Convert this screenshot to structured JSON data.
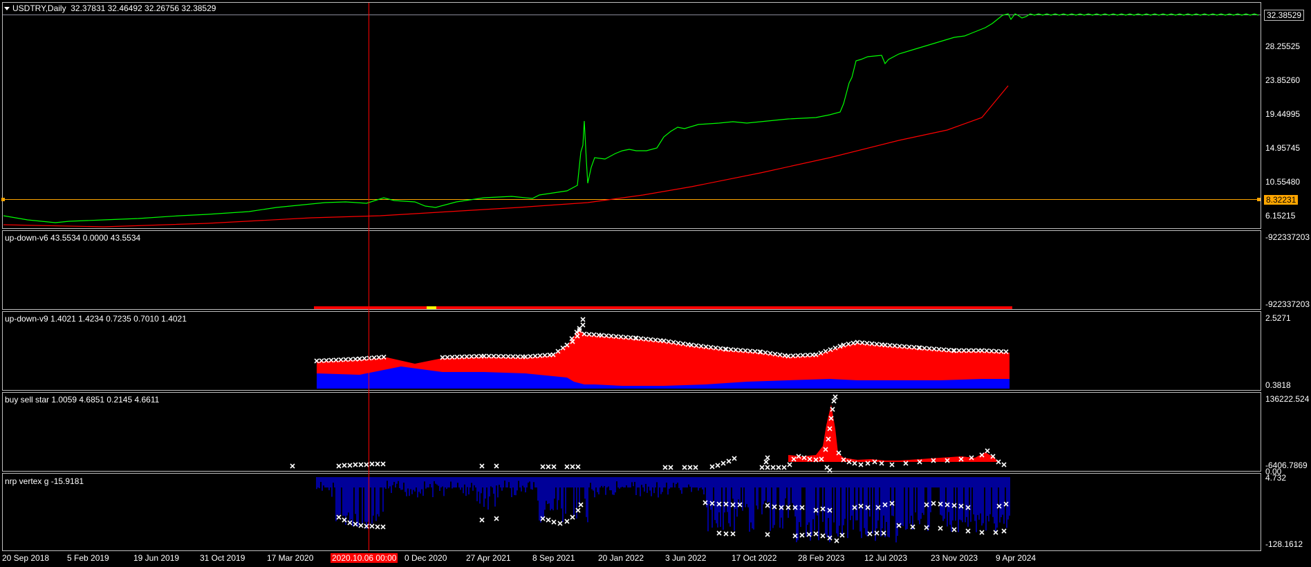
{
  "main": {
    "symbol": "USDTRY,Daily",
    "ohlc": "32.37831 32.46492 32.26756 32.38529",
    "current_price": "32.38529",
    "line_price": "8.32231",
    "scale": [
      "28.25525",
      "23.85260",
      "19.44995",
      "14.95745",
      "10.55480",
      "6.15215"
    ],
    "price_color": "#00ff00",
    "ma_color": "#ff0000",
    "hline_color": "#ffa500"
  },
  "indicators": [
    {
      "title": "up-down-v6  43.5534 0.0000 43.5534",
      "scale_top": "-922337203",
      "scale_bottom": "-922337203"
    },
    {
      "title": "up-down-v9 1.4021 1.4234 0.7235 0.7010 1.4021",
      "scale_top": "2.5271",
      "scale_bottom": "0.3818"
    },
    {
      "title": "buy sell star 1.0059 4.6851 0.2145 4.6611",
      "scale_top": "136222.524",
      "scale_bottom": "-6406.7869",
      "scale_bottom_b": "0.00"
    },
    {
      "title": "nrp vertex g -15.9181",
      "scale_top": "4.732",
      "scale_bottom": "-128.1612"
    }
  ],
  "time_axis": [
    "20 Sep 2018",
    "5 Feb 2019",
    "19 Jun 2019",
    "31 Oct 2019",
    "17 Mar 2020",
    "2020.10.06 00:00",
    "0 Dec 2020",
    "27 Apr 2021",
    "8 Sep 2021",
    "20 Jan 2022",
    "3 Jun 2022",
    "17 Oct 2022",
    "28 Feb 2023",
    "12 Jul 2023",
    "23 Nov 2023",
    "9 Apr 2024"
  ],
  "crosshair_time": "2020.10.06 00:00"
}
